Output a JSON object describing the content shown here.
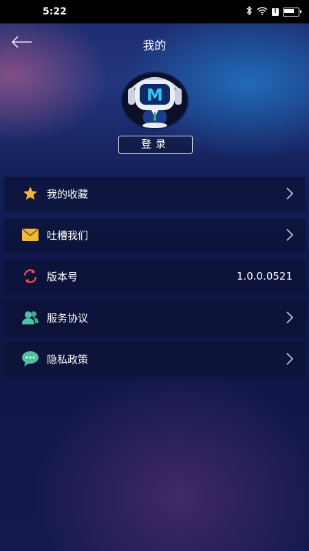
{
  "status_bar": {
    "time": "5:22"
  },
  "header": {
    "title": "我的"
  },
  "profile": {
    "login_label": "登录"
  },
  "menu": [
    {
      "label": "我的收藏",
      "icon": "star-icon",
      "color": "#f3b73b",
      "has_arrow": true
    },
    {
      "label": "吐槽我们",
      "icon": "envelope-icon",
      "color": "#f3b73b",
      "has_arrow": true
    },
    {
      "label": "版本号",
      "icon": "refresh-icon",
      "color": "#e9504d",
      "value": "1.0.0.0521",
      "has_arrow": false
    },
    {
      "label": "服务协议",
      "icon": "users-icon",
      "color": "#4fc1a2",
      "has_arrow": true
    },
    {
      "label": "隐私政策",
      "icon": "chat-icon",
      "color": "#4fc1a2",
      "has_arrow": true
    }
  ]
}
